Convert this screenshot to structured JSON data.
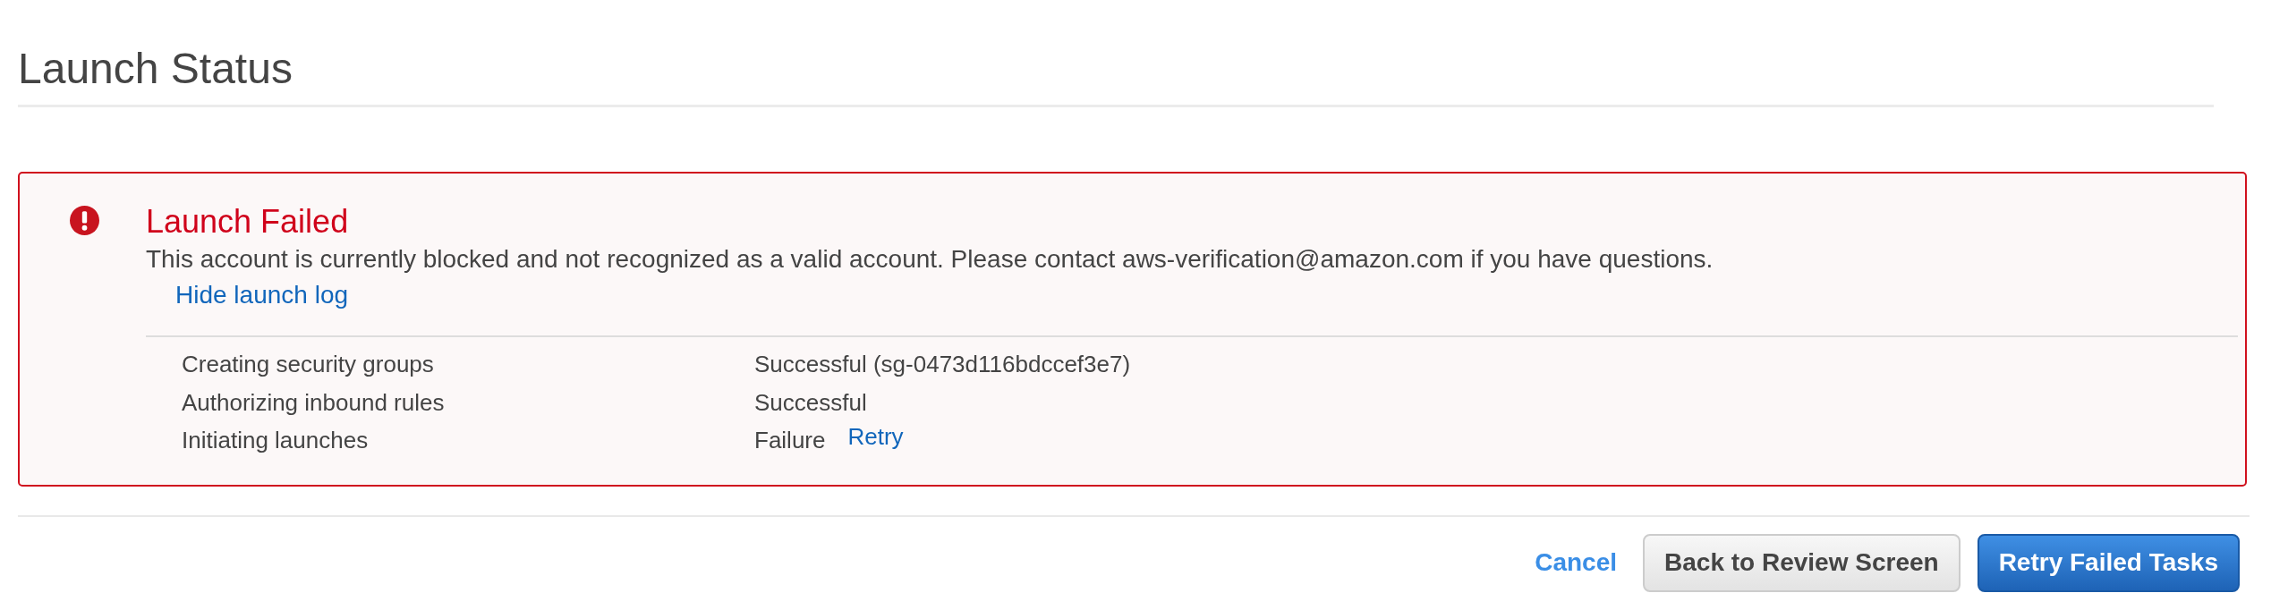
{
  "page": {
    "title": "Launch Status"
  },
  "alert": {
    "kind": "error",
    "title": "Launch Failed",
    "message": "This account is currently blocked and not recognized as a valid account. Please contact aws-verification@amazon.com if you have questions.",
    "log_toggle": "Hide launch log",
    "log": {
      "expanded": true,
      "rows": [
        {
          "step": "Creating security groups",
          "status": "Successful (sg-0473d116bdccef3e7)"
        },
        {
          "step": "Authorizing inbound rules",
          "status": "Successful"
        },
        {
          "step": "Initiating launches",
          "status": "Failure",
          "action": "Retry"
        }
      ]
    }
  },
  "buttons": [
    {
      "kind": "link",
      "label": "Cancel"
    },
    {
      "kind": "secondary",
      "label": "Back to Review Screen"
    },
    {
      "kind": "primary",
      "label": "Retry Failed Tasks"
    }
  ]
}
